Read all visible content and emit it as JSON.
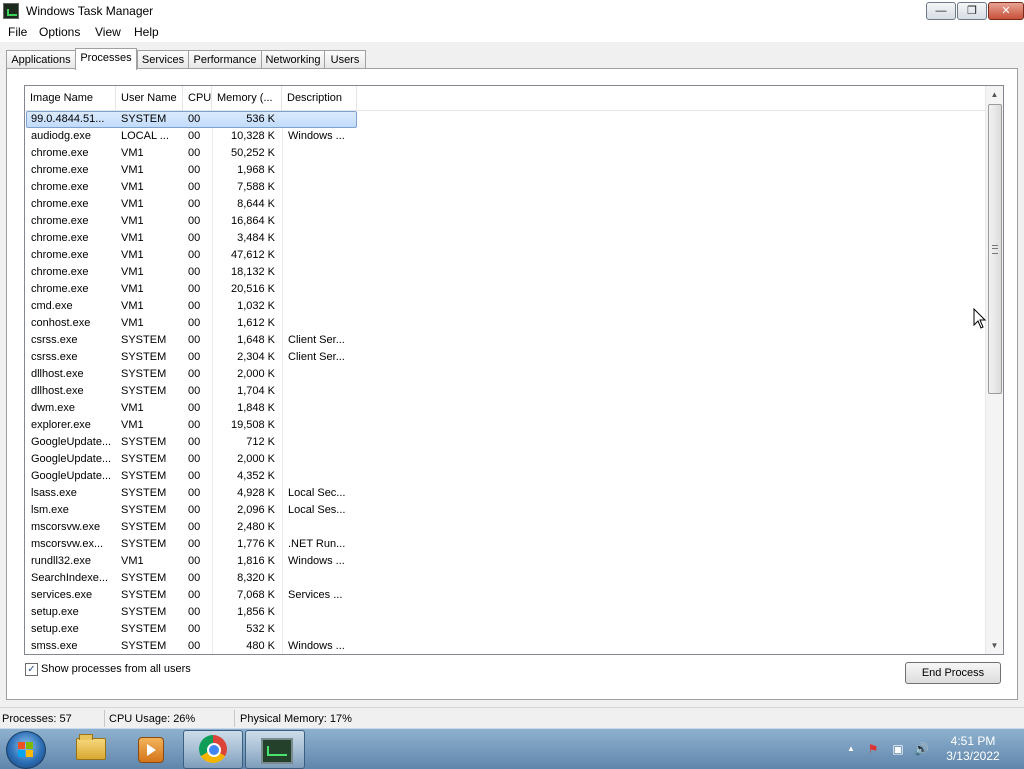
{
  "window": {
    "title": "Windows Task Manager",
    "buttons": {
      "minimize": "—",
      "maximize": "❐",
      "close": "✕"
    }
  },
  "menu": [
    "File",
    "Options",
    "View",
    "Help"
  ],
  "tabs": [
    "Applications",
    "Processes",
    "Services",
    "Performance",
    "Networking",
    "Users"
  ],
  "active_tab": "Processes",
  "table": {
    "columns": [
      "Image Name",
      "User Name",
      "CPU",
      "Memory (...",
      "Description"
    ],
    "rows": [
      {
        "name": "99.0.4844.51...",
        "user": "SYSTEM",
        "cpu": "00",
        "mem": "536 K",
        "desc": ""
      },
      {
        "name": "audiodg.exe",
        "user": "LOCAL ...",
        "cpu": "00",
        "mem": "10,328 K",
        "desc": "Windows ..."
      },
      {
        "name": "chrome.exe",
        "user": "VM1",
        "cpu": "00",
        "mem": "50,252 K",
        "desc": ""
      },
      {
        "name": "chrome.exe",
        "user": "VM1",
        "cpu": "00",
        "mem": "1,968 K",
        "desc": ""
      },
      {
        "name": "chrome.exe",
        "user": "VM1",
        "cpu": "00",
        "mem": "7,588 K",
        "desc": ""
      },
      {
        "name": "chrome.exe",
        "user": "VM1",
        "cpu": "00",
        "mem": "8,644 K",
        "desc": ""
      },
      {
        "name": "chrome.exe",
        "user": "VM1",
        "cpu": "00",
        "mem": "16,864 K",
        "desc": ""
      },
      {
        "name": "chrome.exe",
        "user": "VM1",
        "cpu": "00",
        "mem": "3,484 K",
        "desc": ""
      },
      {
        "name": "chrome.exe",
        "user": "VM1",
        "cpu": "00",
        "mem": "47,612 K",
        "desc": ""
      },
      {
        "name": "chrome.exe",
        "user": "VM1",
        "cpu": "00",
        "mem": "18,132 K",
        "desc": ""
      },
      {
        "name": "chrome.exe",
        "user": "VM1",
        "cpu": "00",
        "mem": "20,516 K",
        "desc": ""
      },
      {
        "name": "cmd.exe",
        "user": "VM1",
        "cpu": "00",
        "mem": "1,032 K",
        "desc": ""
      },
      {
        "name": "conhost.exe",
        "user": "VM1",
        "cpu": "00",
        "mem": "1,612 K",
        "desc": ""
      },
      {
        "name": "csrss.exe",
        "user": "SYSTEM",
        "cpu": "00",
        "mem": "1,648 K",
        "desc": "Client Ser..."
      },
      {
        "name": "csrss.exe",
        "user": "SYSTEM",
        "cpu": "00",
        "mem": "2,304 K",
        "desc": "Client Ser..."
      },
      {
        "name": "dllhost.exe",
        "user": "SYSTEM",
        "cpu": "00",
        "mem": "2,000 K",
        "desc": ""
      },
      {
        "name": "dllhost.exe",
        "user": "SYSTEM",
        "cpu": "00",
        "mem": "1,704 K",
        "desc": ""
      },
      {
        "name": "dwm.exe",
        "user": "VM1",
        "cpu": "00",
        "mem": "1,848 K",
        "desc": ""
      },
      {
        "name": "explorer.exe",
        "user": "VM1",
        "cpu": "00",
        "mem": "19,508 K",
        "desc": ""
      },
      {
        "name": "GoogleUpdate...",
        "user": "SYSTEM",
        "cpu": "00",
        "mem": "712 K",
        "desc": ""
      },
      {
        "name": "GoogleUpdate...",
        "user": "SYSTEM",
        "cpu": "00",
        "mem": "2,000 K",
        "desc": ""
      },
      {
        "name": "GoogleUpdate...",
        "user": "SYSTEM",
        "cpu": "00",
        "mem": "4,352 K",
        "desc": ""
      },
      {
        "name": "lsass.exe",
        "user": "SYSTEM",
        "cpu": "00",
        "mem": "4,928 K",
        "desc": "Local Sec..."
      },
      {
        "name": "lsm.exe",
        "user": "SYSTEM",
        "cpu": "00",
        "mem": "2,096 K",
        "desc": "Local Ses..."
      },
      {
        "name": "mscorsvw.exe",
        "user": "SYSTEM",
        "cpu": "00",
        "mem": "2,480 K",
        "desc": ""
      },
      {
        "name": "mscorsvw.ex...",
        "user": "SYSTEM",
        "cpu": "00",
        "mem": "1,776 K",
        "desc": ".NET Run..."
      },
      {
        "name": "rundll32.exe",
        "user": "VM1",
        "cpu": "00",
        "mem": "1,816 K",
        "desc": "Windows ..."
      },
      {
        "name": "SearchIndexe...",
        "user": "SYSTEM",
        "cpu": "00",
        "mem": "8,320 K",
        "desc": ""
      },
      {
        "name": "services.exe",
        "user": "SYSTEM",
        "cpu": "00",
        "mem": "7,068 K",
        "desc": "Services ..."
      },
      {
        "name": "setup.exe",
        "user": "SYSTEM",
        "cpu": "00",
        "mem": "1,856 K",
        "desc": ""
      },
      {
        "name": "setup.exe",
        "user": "SYSTEM",
        "cpu": "00",
        "mem": "532 K",
        "desc": ""
      },
      {
        "name": "smss.exe",
        "user": "SYSTEM",
        "cpu": "00",
        "mem": "480 K",
        "desc": "Windows ..."
      }
    ]
  },
  "show_all_users": {
    "label": "Show processes from all users",
    "checked": true,
    "mark": "✓"
  },
  "end_process_label": "End Process",
  "status": {
    "processes": "Processes: 57",
    "cpu": "CPU Usage: 26%",
    "memory": "Physical Memory: 17%"
  },
  "taskbar": {
    "time": "4:51 PM",
    "date": "3/13/2022",
    "tray": [
      "▲",
      "⚑",
      "▣",
      "🔊"
    ]
  },
  "colors": {
    "selection": "#cce4fc",
    "taskbar": "#6f93b8"
  }
}
